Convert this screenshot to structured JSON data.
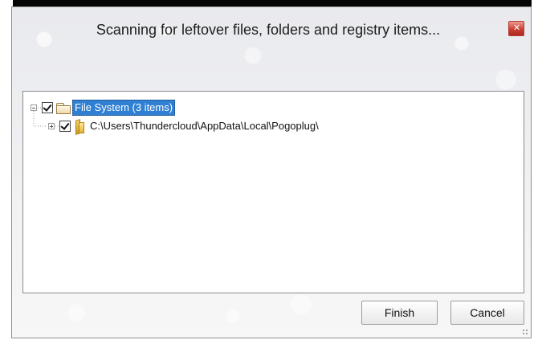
{
  "window": {
    "title": "Scanning for leftover files, folders and registry items...",
    "close_icon": "close-icon"
  },
  "tree": {
    "root": {
      "label": "File System (3 items)",
      "checked": true,
      "expanded": true,
      "icon": "folder-icon"
    },
    "children": [
      {
        "label": "C:\\Users\\Thundercloud\\AppData\\Local\\Pogoplug\\",
        "checked": true,
        "expanded": false,
        "icon": "folder-icon"
      }
    ]
  },
  "buttons": {
    "finish": "Finish",
    "cancel": "Cancel"
  },
  "colors": {
    "selection": "#2f7fd3",
    "close_button": "#c93f34"
  }
}
